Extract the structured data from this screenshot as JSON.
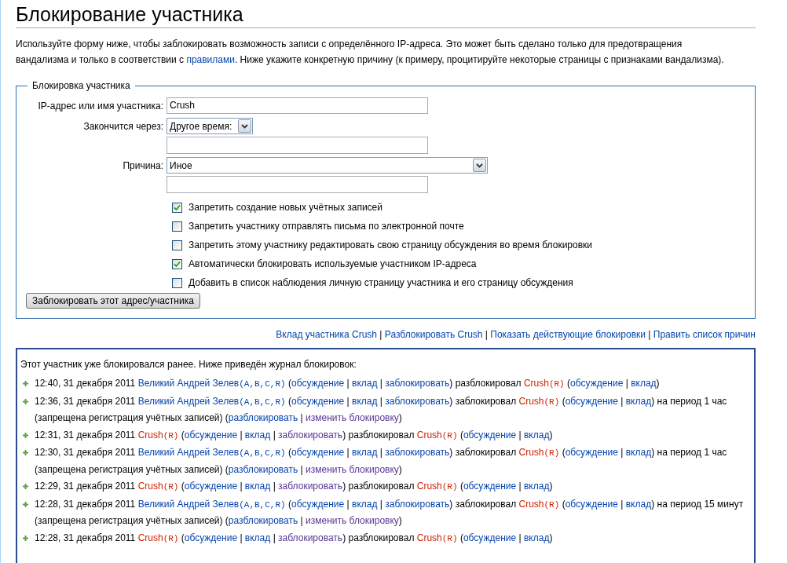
{
  "page_title": "Блокирование участника",
  "intro": {
    "before": "Используйте форму ниже, чтобы заблокировать возможность записи с определённого IP-адреса. Это может быть сделано только для предотвращения вандализма и только в соответствии с ",
    "link": "правилами",
    "after": ". Ниже укажите конкретную причину (к примеру, процитируйте некоторые страницы с признаками вандализма)."
  },
  "form": {
    "legend": "Блокировка участника",
    "fields": [
      {
        "kind": "text",
        "label": "IP-адрес или имя участника:",
        "value": "Crush"
      },
      {
        "kind": "select_other",
        "label": "Закончится через:",
        "value": "Другое время:",
        "wide": false
      },
      {
        "kind": "select_other",
        "label": "Причина:",
        "value": "Иное",
        "wide": true
      }
    ],
    "checkboxes": [
      {
        "label": "Запретить создание новых учётных записей",
        "checked": true
      },
      {
        "label": "Запретить участнику отправлять письма по электронной почте",
        "checked": false
      },
      {
        "label": "Запретить этому участнику редактировать свою страницу обсуждения во время блокировки",
        "checked": false
      },
      {
        "label": "Автоматически блокировать используемые участником IP-адреса",
        "checked": true
      },
      {
        "label": "Добавить в список наблюдения личную страницу участника и его страницу обсуждения",
        "checked": false
      }
    ],
    "submit": "Заблокировать этот адрес/участника"
  },
  "links": [
    {
      "kind": "link",
      "text": "Вклад участника Crush"
    },
    {
      "kind": "plain",
      "text": " | "
    },
    {
      "kind": "link",
      "text": "Разблокировать Crush"
    },
    {
      "kind": "plain",
      "text": " | "
    },
    {
      "kind": "link",
      "text": "Показать действующие блокировки"
    },
    {
      "kind": "plain",
      "text": " | "
    },
    {
      "kind": "link",
      "text": "Править список причин"
    }
  ],
  "log": {
    "intro": "Этот участник уже блокировался ранее. Ниже приведён журнал блокировок:",
    "entries": [
      {
        "parts": [
          {
            "kind": "plain",
            "text": "12:40, 31 декабря 2011 "
          },
          {
            "kind": "link",
            "text": "Великий Андрей Зелев"
          },
          {
            "kind": "link_code",
            "text": "(A,B,C,R)"
          },
          {
            "kind": "plain",
            "text": " ("
          },
          {
            "kind": "link",
            "text": "обсуждение"
          },
          {
            "kind": "plain",
            "text": " | "
          },
          {
            "kind": "link",
            "text": "вклад"
          },
          {
            "kind": "plain",
            "text": " | "
          },
          {
            "kind": "link",
            "text": "заблокировать"
          },
          {
            "kind": "plain",
            "text": ") разблокировал "
          },
          {
            "kind": "new",
            "text": "Crush"
          },
          {
            "kind": "new_code",
            "text": "(R)"
          },
          {
            "kind": "plain",
            "text": " ("
          },
          {
            "kind": "link",
            "text": "обсуждение"
          },
          {
            "kind": "plain",
            "text": " | "
          },
          {
            "kind": "link",
            "text": "вклад"
          },
          {
            "kind": "plain",
            "text": ")"
          }
        ]
      },
      {
        "parts": [
          {
            "kind": "plain",
            "text": "12:36, 31 декабря 2011 "
          },
          {
            "kind": "link",
            "text": "Великий Андрей Зелев"
          },
          {
            "kind": "link_code",
            "text": "(A,B,C,R)"
          },
          {
            "kind": "plain",
            "text": " ("
          },
          {
            "kind": "link",
            "text": "обсуждение"
          },
          {
            "kind": "plain",
            "text": " | "
          },
          {
            "kind": "link",
            "text": "вклад"
          },
          {
            "kind": "plain",
            "text": " | "
          },
          {
            "kind": "link",
            "text": "заблокировать"
          },
          {
            "kind": "plain",
            "text": ") заблокировал "
          },
          {
            "kind": "new",
            "text": "Crush"
          },
          {
            "kind": "new_code",
            "text": "(R)"
          },
          {
            "kind": "plain",
            "text": " ("
          },
          {
            "kind": "link",
            "text": "обсуждение"
          },
          {
            "kind": "plain",
            "text": " | "
          },
          {
            "kind": "link",
            "text": "вклад"
          },
          {
            "kind": "plain",
            "text": ") на период 1 час (запрещена регистрация учётных записей) ("
          },
          {
            "kind": "link",
            "text": "разблокировать"
          },
          {
            "kind": "plain",
            "text": " | "
          },
          {
            "kind": "visited",
            "text": "изменить блокировку"
          },
          {
            "kind": "plain",
            "text": ")"
          }
        ]
      },
      {
        "parts": [
          {
            "kind": "plain",
            "text": "12:31, 31 декабря 2011 "
          },
          {
            "kind": "new",
            "text": "Crush"
          },
          {
            "kind": "new_code",
            "text": "(R)"
          },
          {
            "kind": "plain",
            "text": " ("
          },
          {
            "kind": "link",
            "text": "обсуждение"
          },
          {
            "kind": "plain",
            "text": " | "
          },
          {
            "kind": "link",
            "text": "вклад"
          },
          {
            "kind": "plain",
            "text": " | "
          },
          {
            "kind": "visited",
            "text": "заблокировать"
          },
          {
            "kind": "plain",
            "text": ") разблокировал "
          },
          {
            "kind": "new",
            "text": "Crush"
          },
          {
            "kind": "new_code",
            "text": "(R)"
          },
          {
            "kind": "plain",
            "text": " ("
          },
          {
            "kind": "link",
            "text": "обсуждение"
          },
          {
            "kind": "plain",
            "text": " | "
          },
          {
            "kind": "link",
            "text": "вклад"
          },
          {
            "kind": "plain",
            "text": ")"
          }
        ]
      },
      {
        "parts": [
          {
            "kind": "plain",
            "text": "12:30, 31 декабря 2011 "
          },
          {
            "kind": "link",
            "text": "Великий Андрей Зелев"
          },
          {
            "kind": "link_code",
            "text": "(A,B,C,R)"
          },
          {
            "kind": "plain",
            "text": " ("
          },
          {
            "kind": "link",
            "text": "обсуждение"
          },
          {
            "kind": "plain",
            "text": " | "
          },
          {
            "kind": "link",
            "text": "вклад"
          },
          {
            "kind": "plain",
            "text": " | "
          },
          {
            "kind": "link",
            "text": "заблокировать"
          },
          {
            "kind": "plain",
            "text": ") заблокировал "
          },
          {
            "kind": "new",
            "text": "Crush"
          },
          {
            "kind": "new_code",
            "text": "(R)"
          },
          {
            "kind": "plain",
            "text": " ("
          },
          {
            "kind": "link",
            "text": "обсуждение"
          },
          {
            "kind": "plain",
            "text": " | "
          },
          {
            "kind": "link",
            "text": "вклад"
          },
          {
            "kind": "plain",
            "text": ") на период 1 час (запрещена регистрация учётных записей) ("
          },
          {
            "kind": "link",
            "text": "разблокировать"
          },
          {
            "kind": "plain",
            "text": " | "
          },
          {
            "kind": "visited",
            "text": "изменить блокировку"
          },
          {
            "kind": "plain",
            "text": ")"
          }
        ]
      },
      {
        "parts": [
          {
            "kind": "plain",
            "text": "12:29, 31 декабря 2011 "
          },
          {
            "kind": "new",
            "text": "Crush"
          },
          {
            "kind": "new_code",
            "text": "(R)"
          },
          {
            "kind": "plain",
            "text": " ("
          },
          {
            "kind": "link",
            "text": "обсуждение"
          },
          {
            "kind": "plain",
            "text": " | "
          },
          {
            "kind": "link",
            "text": "вклад"
          },
          {
            "kind": "plain",
            "text": " | "
          },
          {
            "kind": "visited",
            "text": "заблокировать"
          },
          {
            "kind": "plain",
            "text": ") разблокировал "
          },
          {
            "kind": "new",
            "text": "Crush"
          },
          {
            "kind": "new_code",
            "text": "(R)"
          },
          {
            "kind": "plain",
            "text": " ("
          },
          {
            "kind": "link",
            "text": "обсуждение"
          },
          {
            "kind": "plain",
            "text": " | "
          },
          {
            "kind": "link",
            "text": "вклад"
          },
          {
            "kind": "plain",
            "text": ")"
          }
        ]
      },
      {
        "parts": [
          {
            "kind": "plain",
            "text": "12:28, 31 декабря 2011 "
          },
          {
            "kind": "link",
            "text": "Великий Андрей Зелев"
          },
          {
            "kind": "link_code",
            "text": "(A,B,C,R)"
          },
          {
            "kind": "plain",
            "text": " ("
          },
          {
            "kind": "link",
            "text": "обсуждение"
          },
          {
            "kind": "plain",
            "text": " | "
          },
          {
            "kind": "link",
            "text": "вклад"
          },
          {
            "kind": "plain",
            "text": " | "
          },
          {
            "kind": "link",
            "text": "заблокировать"
          },
          {
            "kind": "plain",
            "text": ") заблокировал "
          },
          {
            "kind": "new",
            "text": "Crush"
          },
          {
            "kind": "new_code",
            "text": "(R)"
          },
          {
            "kind": "plain",
            "text": " ("
          },
          {
            "kind": "link",
            "text": "обсуждение"
          },
          {
            "kind": "plain",
            "text": " | "
          },
          {
            "kind": "link",
            "text": "вклад"
          },
          {
            "kind": "plain",
            "text": ") на период 15 минут (запрещена регистрация учётных записей) ("
          },
          {
            "kind": "link",
            "text": "разблокировать"
          },
          {
            "kind": "plain",
            "text": " | "
          },
          {
            "kind": "visited",
            "text": "изменить блокировку"
          },
          {
            "kind": "plain",
            "text": ")"
          }
        ]
      },
      {
        "parts": [
          {
            "kind": "plain",
            "text": "12:28, 31 декабря 2011 "
          },
          {
            "kind": "new",
            "text": "Crush"
          },
          {
            "kind": "new_code",
            "text": "(R)"
          },
          {
            "kind": "plain",
            "text": " ("
          },
          {
            "kind": "link",
            "text": "обсуждение"
          },
          {
            "kind": "plain",
            "text": " | "
          },
          {
            "kind": "link",
            "text": "вклад"
          },
          {
            "kind": "plain",
            "text": " | "
          },
          {
            "kind": "visited",
            "text": "заблокировать"
          },
          {
            "kind": "plain",
            "text": ") разблокировал "
          },
          {
            "kind": "new",
            "text": "Crush"
          },
          {
            "kind": "new_code",
            "text": "(R)"
          },
          {
            "kind": "plain",
            "text": " ("
          },
          {
            "kind": "link",
            "text": "обсуждение"
          },
          {
            "kind": "plain",
            "text": " | "
          },
          {
            "kind": "link",
            "text": "вклад"
          },
          {
            "kind": "plain",
            "text": ")"
          }
        ]
      }
    ]
  }
}
